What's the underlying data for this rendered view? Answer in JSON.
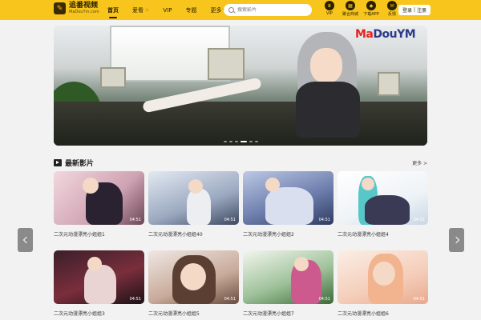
{
  "header": {
    "logo_name": "追番视频",
    "logo_url": "MaDouYm.com",
    "nav": [
      {
        "label": "首页",
        "active": true
      },
      {
        "label": "爱看",
        "active": false
      },
      {
        "label": "VIP",
        "active": false
      },
      {
        "label": "专题",
        "active": false
      },
      {
        "label": "更多",
        "active": false
      }
    ],
    "search_placeholder": "搜索影片",
    "tools": [
      {
        "label": "VIP",
        "icon": "crown-icon"
      },
      {
        "label": "聚合商城",
        "icon": "shop-icon"
      },
      {
        "label": "下载APP",
        "icon": "app-icon"
      },
      {
        "label": "反馈",
        "icon": "feedback-icon"
      }
    ],
    "login": "登录",
    "separator": "|",
    "register": "注册"
  },
  "banner": {
    "watermark_a": "Ma",
    "watermark_b": "DouYM"
  },
  "section": {
    "title": "最新影片",
    "more": "更多 >"
  },
  "cards": [
    {
      "title": "二次元动漫漂亮小姐姐1",
      "duration": "04:51"
    },
    {
      "title": "二次元动漫漂亮小姐姐40",
      "duration": "04:51"
    },
    {
      "title": "二次元动漫漂亮小姐姐2",
      "duration": "04:51"
    },
    {
      "title": "二次元动漫漂亮小姐姐4",
      "duration": "04:51"
    },
    {
      "title": "二次元动漫漂亮小姐姐3",
      "duration": "04:51"
    },
    {
      "title": "二次元动漫漂亮小姐姐5",
      "duration": "04:51"
    },
    {
      "title": "二次元动漫漂亮小姐姐7",
      "duration": "04:51"
    },
    {
      "title": "二次元动漫漂亮小姐姐6",
      "duration": "04:51"
    }
  ],
  "colors": {
    "accent": "#f8c51c",
    "arrow": "#8a8a8a"
  }
}
